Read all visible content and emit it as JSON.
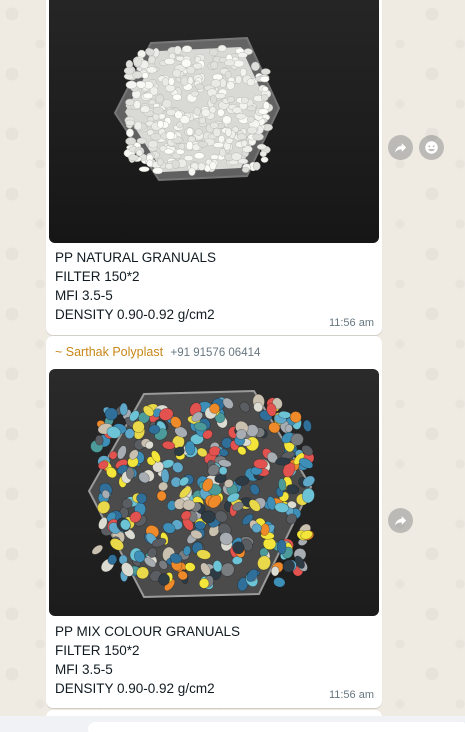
{
  "messages": [
    {
      "caption": [
        "PP NATURAL GRANUALS",
        "FILTER 150*2",
        "MFI 3.5-5",
        "DENSITY 0.90-0.92 g/cm2"
      ],
      "time": "11:56 am"
    },
    {
      "sender_name": "~ Sarthak Polyplast",
      "sender_phone": "+91 91576 06414",
      "caption": [
        "PP MIX COLOUR GRANUALS",
        "FILTER 150*2",
        "MFI 3.5-5",
        "DENSITY 0.90-0.92 g/cm2"
      ],
      "time": "11:56 am"
    }
  ],
  "icons": {
    "forward": "forward-icon",
    "react": "emoji-icon"
  },
  "colors": {
    "chat_background": "#efeae2",
    "bubble": "#ffffff",
    "sender_name": "#c88719",
    "meta_text": "#667781"
  }
}
